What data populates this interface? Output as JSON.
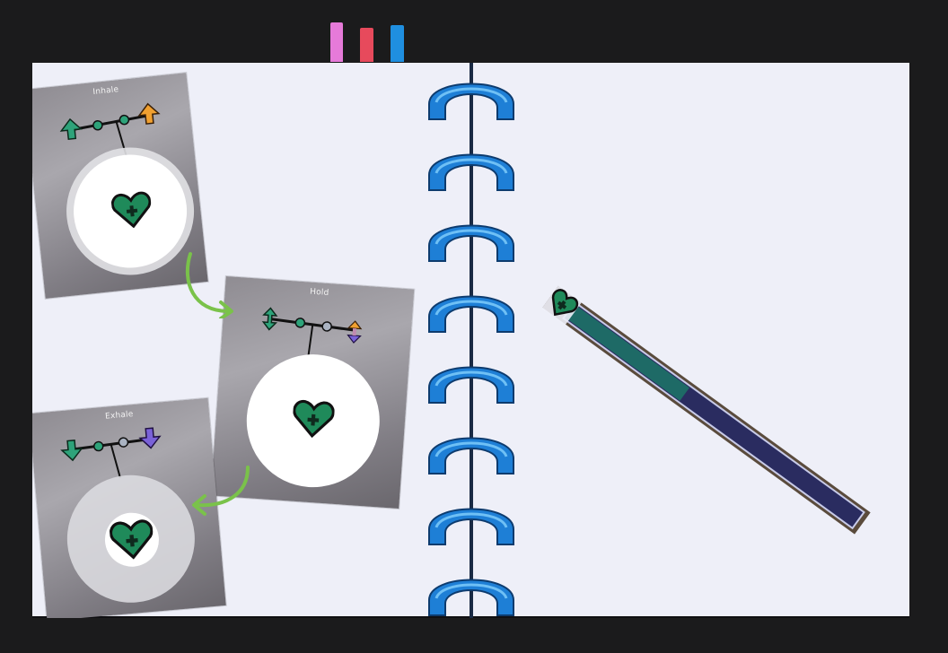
{
  "tabs": [
    {
      "color": "#e67ad9"
    },
    {
      "color": "#e74a5c"
    },
    {
      "color": "#1f8fe0"
    }
  ],
  "colors": {
    "background": "#1b1b1c",
    "paper": "#eeeff8",
    "spiral": "#1e7fd6",
    "heart_fill": "#1f8a5a",
    "arrow_green": "#2ea37a",
    "arrow_orange": "#f0a030",
    "arrow_purple": "#7a62d8",
    "connector": "#7ac24a",
    "bar_fill": "#2a2c60",
    "bar_progress": "#1e6a66"
  },
  "cards": [
    {
      "title": "Inhale",
      "left_icon": "up-arrow-icon",
      "right_icon": "up-arrow-icon"
    },
    {
      "title": "Hold",
      "left_icon": "up-down-arrow-icon",
      "right_icon": "up-down-arrow-icon"
    },
    {
      "title": "Exhale",
      "left_icon": "down-arrow-icon",
      "right_icon": "down-arrow-icon"
    }
  ],
  "breath_bar": {
    "progress": 0.4,
    "icon": "heart-icon"
  }
}
